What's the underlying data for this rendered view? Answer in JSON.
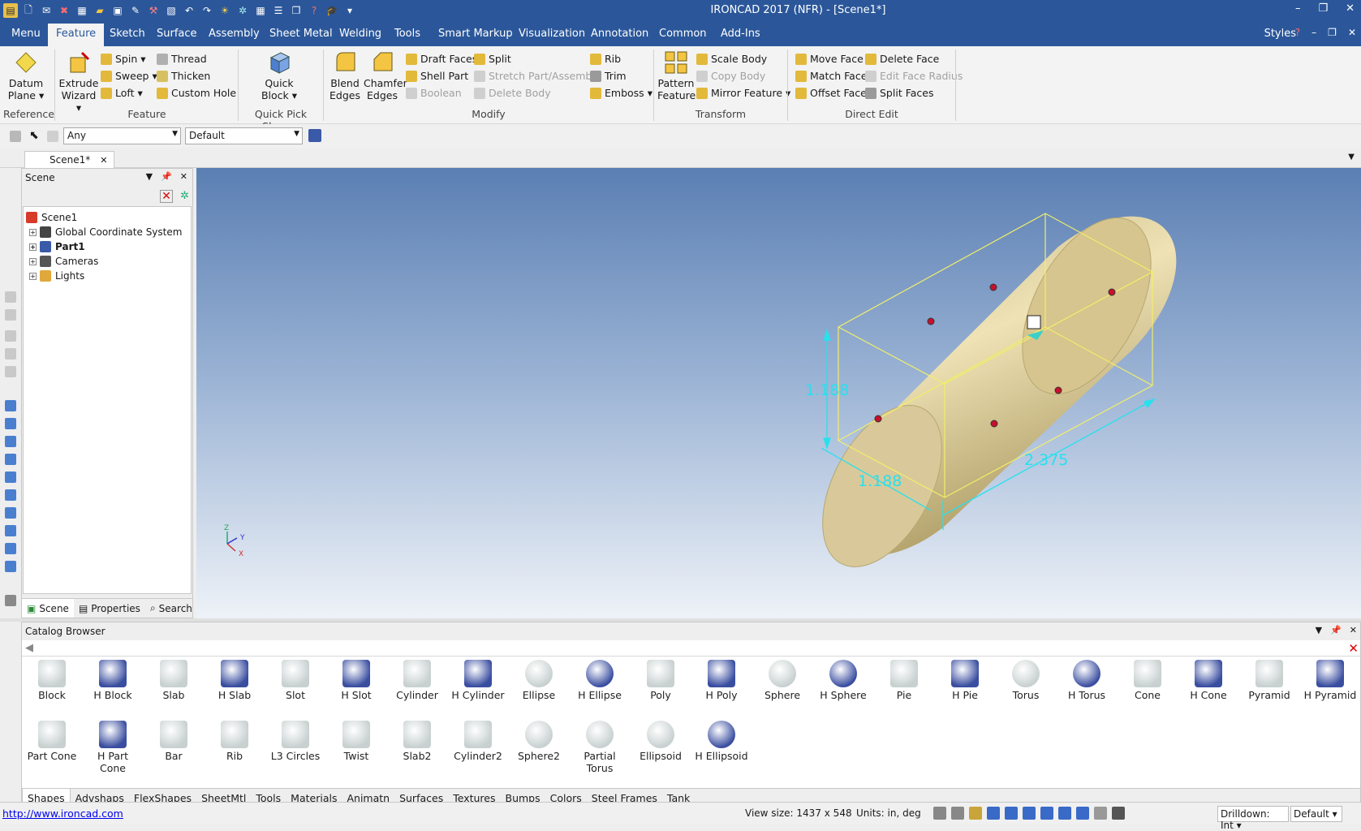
{
  "app": {
    "title": "IRONCAD 2017 (NFR) - [Scene1*]",
    "window_controls": [
      "–",
      "❐",
      "✕"
    ]
  },
  "menu": {
    "items": [
      "Menu",
      "Feature",
      "Sketch",
      "Surface",
      "Assembly",
      "Sheet Metal",
      "Welding",
      "Tools",
      "Smart Markup",
      "Visualization",
      "Annotation",
      "Common",
      "Add-Ins"
    ],
    "active": "Feature",
    "styles_label": "Styles"
  },
  "ribbon": {
    "datum_plane": "Datum\nPlane",
    "reference_label": "Reference",
    "extrude_wizard": "Extrude\nWizard",
    "feature_small": [
      "Spin",
      "Sweep",
      "Loft"
    ],
    "feature_small2": [
      "Thread",
      "Thicken",
      "Custom Hole"
    ],
    "feature_label": "Feature",
    "quick_block": "Quick\nBlock",
    "quick_pick_label": "Quick Pick Shapes",
    "blend_edges": "Blend\nEdges",
    "chamfer_edges": "Chamfer\nEdges",
    "modify_col1": [
      "Draft Faces",
      "Shell Part",
      "Boolean"
    ],
    "modify_col2": [
      "Split",
      "Stretch Part/Assembly",
      "Delete Body"
    ],
    "modify_col3": [
      "Rib",
      "Trim",
      "Emboss"
    ],
    "modify_label": "Modify",
    "pattern_feature": "Pattern\nFeature",
    "transform_col": [
      "Scale Body",
      "Copy Body",
      "Mirror Feature"
    ],
    "transform_label": "Transform",
    "direct_col1": [
      "Move Face",
      "Match Face",
      "Offset Face"
    ],
    "direct_col2": [
      "Delete Face",
      "Edit Face Radius",
      "Split Faces"
    ],
    "direct_label": "Direct Edit"
  },
  "toolbar2": {
    "filter_value": "Any",
    "style_value": "Default"
  },
  "doc_tab": "Scene1*",
  "scene_panel": {
    "title": "Scene",
    "tree": [
      {
        "label": "Scene1",
        "bold": false
      },
      {
        "label": "Global Coordinate System",
        "bold": false
      },
      {
        "label": "Part1",
        "bold": true
      },
      {
        "label": "Cameras",
        "bold": false
      },
      {
        "label": "Lights",
        "bold": false
      }
    ],
    "tabs": [
      "Scene",
      "Properties",
      "Search"
    ]
  },
  "viewport": {
    "dim_height": "1.188",
    "dim_width": "1.188",
    "dim_length": "2.375",
    "axis_labels": [
      "Z",
      "Y",
      "X"
    ],
    "colors": {
      "part": "#d9c99a",
      "bbox": "#f2ee6a",
      "dims": "#28e0ee",
      "handles": "#c8102e"
    }
  },
  "catalog": {
    "title": "Catalog Browser",
    "row1": [
      "Block",
      "H Block",
      "Slab",
      "H Slab",
      "Slot",
      "H Slot",
      "Cylinder",
      "H Cylinder",
      "Ellipse",
      "H Ellipse",
      "Poly",
      "H Poly",
      "Sphere",
      "H Sphere",
      "Pie",
      "H Pie",
      "Torus",
      "H Torus",
      "Cone",
      "H Cone",
      "Pyramid",
      "H Pyramid"
    ],
    "row2": [
      "Part Cone",
      "H Part Cone",
      "Bar",
      "Rib",
      "L3 Circles",
      "Twist",
      "Slab2",
      "Cylinder2",
      "Sphere2",
      "Partial Torus",
      "Ellipsoid",
      "H Ellipsoid"
    ],
    "tabs": [
      "Shapes",
      "Advshaps",
      "FlexShapes",
      "SheetMtl",
      "Tools",
      "Materials",
      "Animatn",
      "Surfaces",
      "Textures",
      "Bumps",
      "Colors",
      "Steel Frames",
      "Tank"
    ]
  },
  "status": {
    "url": "http://www.ironcad.com",
    "view_size": "View size: 1437 x  548",
    "units": "Units: in, deg",
    "drilldown": "Drilldown: Int",
    "default": "Default"
  }
}
